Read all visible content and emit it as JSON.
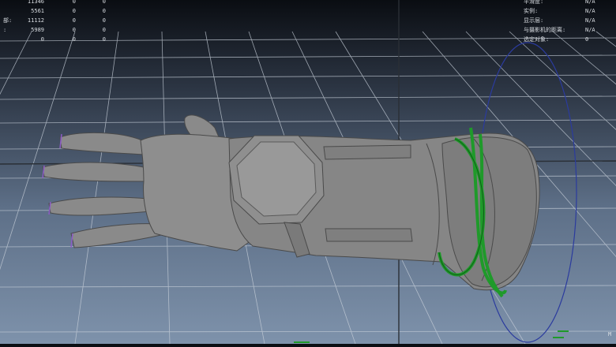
{
  "viewport": {
    "name": "3D viewport",
    "colors": {
      "grid": "#c8d0da",
      "axis": "#2a2f36",
      "mesh": "#8b8b8b",
      "mesh_dark": "#6f6f6f",
      "nail_highlight": "#8d5cc6",
      "curve_green": "#1f9a2a",
      "curve_blue": "#2b3b9e"
    }
  },
  "hud_left": {
    "rows": [
      {
        "label": "",
        "c1": "11346",
        "c2": "0",
        "c3": "0"
      },
      {
        "label": "",
        "c1": "5561",
        "c2": "0",
        "c3": "0"
      },
      {
        "label": "部:",
        "c1": "11112",
        "c2": "0",
        "c3": "0"
      },
      {
        "label": ":",
        "c1": "5989",
        "c2": "0",
        "c3": "0"
      },
      {
        "label": "",
        "c1": "0",
        "c2": "0",
        "c3": "0"
      }
    ]
  },
  "hud_right": {
    "rows": [
      {
        "label": "平滑度:",
        "value": "N/A"
      },
      {
        "label": "实例:",
        "value": "N/A"
      },
      {
        "label": "显示层:",
        "value": "N/A"
      },
      {
        "label": "与摄影机的距离:",
        "value": "N/A"
      },
      {
        "label": "选定对象:",
        "value": "0"
      }
    ]
  },
  "corner": {
    "bottom_right": "M"
  },
  "icons": [
    "axis-gizmo-icon"
  ]
}
